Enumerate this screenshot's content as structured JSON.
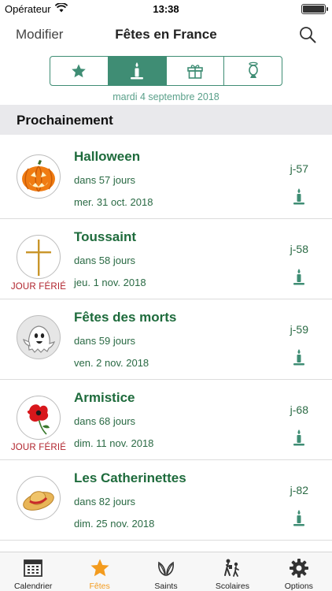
{
  "status_bar": {
    "carrier": "Opérateur",
    "time": "13:38",
    "battery_level": 1.0
  },
  "nav": {
    "left_button": "Modifier",
    "title": "Fêtes en France",
    "search_icon": "magnifier-icon"
  },
  "segments": [
    {
      "icon": "star-icon",
      "selected": false
    },
    {
      "icon": "candle-icon",
      "selected": true
    },
    {
      "icon": "gift-icon",
      "selected": false
    },
    {
      "icon": "saint-bust-icon",
      "selected": false
    }
  ],
  "date_line": "mardi 4 septembre 2018",
  "section": {
    "title": "Prochainement"
  },
  "events": [
    {
      "name": "Halloween",
      "relative": "dans 57 jours",
      "date": "mer. 31 oct. 2018",
      "countdown": "j-57",
      "icon": "pumpkin-icon",
      "tag": ""
    },
    {
      "name": "Toussaint",
      "relative": "dans 58 jours",
      "date": "jeu. 1 nov. 2018",
      "countdown": "j-58",
      "icon": "cross-icon",
      "tag": "JOUR FÉRIÉ"
    },
    {
      "name": "Fêtes des morts",
      "relative": "dans 59 jours",
      "date": "ven. 2 nov. 2018",
      "countdown": "j-59",
      "icon": "ghost-icon",
      "tag": ""
    },
    {
      "name": "Armistice",
      "relative": "dans 68 jours",
      "date": "dim. 11 nov. 2018",
      "countdown": "j-68",
      "icon": "poppy-icon",
      "tag": "JOUR FÉRIÉ"
    },
    {
      "name": "Les Catherinettes",
      "relative": "dans 82 jours",
      "date": "dim. 25 nov. 2018",
      "countdown": "j-82",
      "icon": "straw-hat-icon",
      "tag": ""
    }
  ],
  "tabs": [
    {
      "label": "Calendrier",
      "icon": "calendar-icon",
      "active": false
    },
    {
      "label": "Fêtes",
      "icon": "star-icon",
      "active": true
    },
    {
      "label": "Saints",
      "icon": "laurel-icon",
      "active": false
    },
    {
      "label": "Scolaires",
      "icon": "schoolchildren-icon",
      "active": false
    },
    {
      "label": "Options",
      "icon": "gear-icon",
      "active": false
    }
  ],
  "colors": {
    "accent": "#3f8d74",
    "title_green": "#1e6b3c",
    "holiday_red": "#b0232c",
    "tab_active": "#f39b1e"
  }
}
